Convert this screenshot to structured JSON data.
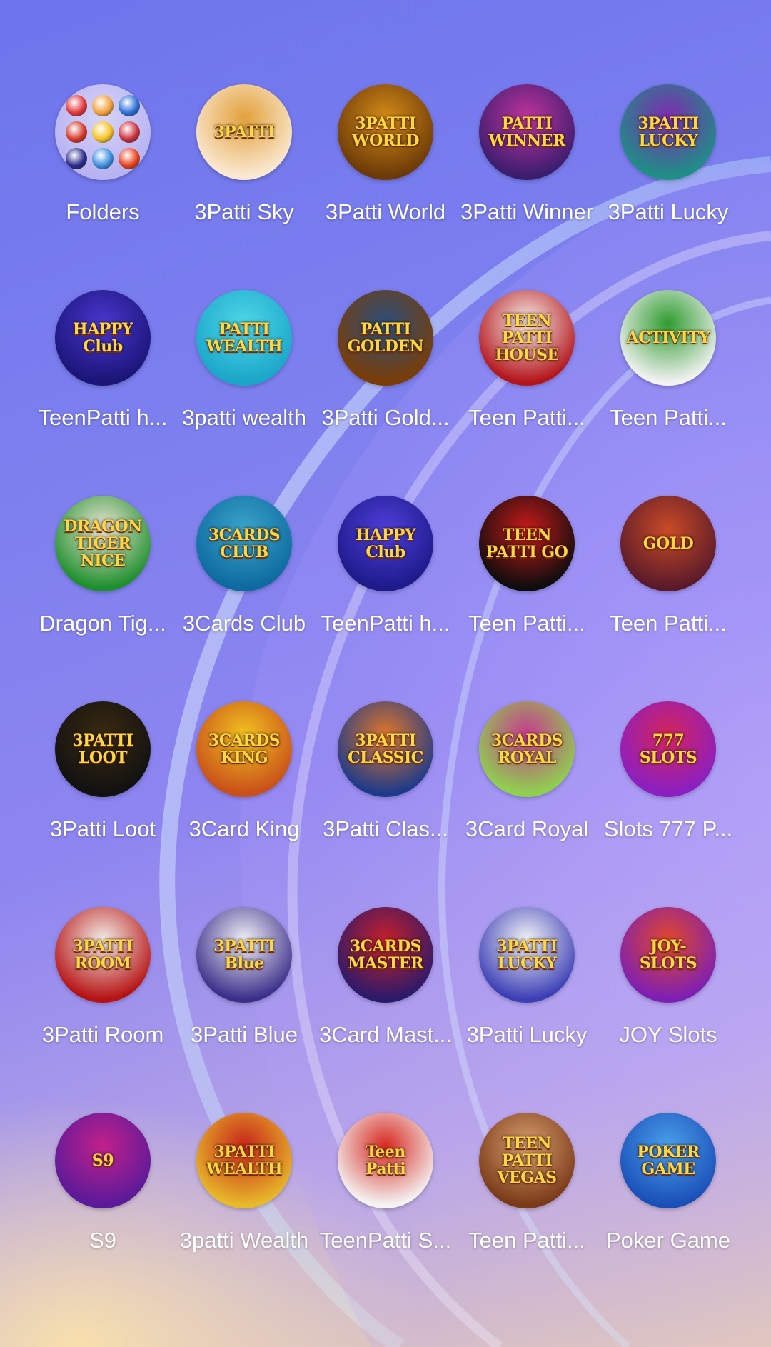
{
  "home_screen": {
    "apps": [
      {
        "label": "Folders",
        "icon": "folder-icon",
        "kind": "folder",
        "icon_text": "",
        "colors": [
          "#b7b2f2",
          "#d6d3f7"
        ]
      },
      {
        "label": "3Patti Sky",
        "icon": "3patti-sky-icon",
        "icon_text": "3PATTI",
        "colors": [
          "#fbe9d3",
          "#e2a13a"
        ]
      },
      {
        "label": "3Patti World",
        "icon": "3patti-world-icon",
        "icon_text": "3PATTI WORLD",
        "colors": [
          "#6b3a07",
          "#d48a18"
        ]
      },
      {
        "label": "3Patti Winner",
        "icon": "3patti-winner-icon",
        "icon_text": "PATTI WINNER",
        "colors": [
          "#3a1d6e",
          "#c0339b"
        ]
      },
      {
        "label": "3Patti Lucky",
        "icon": "3patti-lucky-icon",
        "icon_text": "3PATTI LUCKY",
        "colors": [
          "#1e8f86",
          "#7e2ab0"
        ]
      },
      {
        "label": "TeenPatti h...",
        "icon": "teenpatti-happy-club-icon",
        "icon_text": "HAPPY Club",
        "colors": [
          "#1a1577",
          "#4a36d0"
        ]
      },
      {
        "label": "3patti wealth",
        "icon": "3patti-wealth-icon",
        "icon_text": "PATTI WEALTH",
        "colors": [
          "#1ba6c9",
          "#4dd7e8"
        ]
      },
      {
        "label": "3Patti Gold...",
        "icon": "3patti-golden-icon",
        "icon_text": "PATTI GOLDEN",
        "colors": [
          "#7a3d07",
          "#2b4e7a"
        ]
      },
      {
        "label": "Teen Patti...",
        "icon": "teen-patti-house-icon",
        "icon_text": "TEEN PATTI HOUSE",
        "colors": [
          "#b3141a",
          "#f7f0ea"
        ]
      },
      {
        "label": "Teen Patti...",
        "icon": "teen-patti-activity-icon",
        "icon_text": "ACTIVITY",
        "colors": [
          "#f2f2f2",
          "#2f9c2f"
        ]
      },
      {
        "label": "Dragon Tig...",
        "icon": "dragon-tiger-icon",
        "icon_text": "DRAGON TIGER NICE",
        "colors": [
          "#1d8f2c",
          "#f0e6d8"
        ]
      },
      {
        "label": "3Cards Club",
        "icon": "3cards-club-icon",
        "icon_text": "3CARDS CLUB",
        "colors": [
          "#0e6aa0",
          "#3aa4c9"
        ]
      },
      {
        "label": "TeenPatti h...",
        "icon": "teenpatti-happy-club-2-icon",
        "icon_text": "HAPPY Club",
        "colors": [
          "#1d1a8a",
          "#4f3ed9"
        ]
      },
      {
        "label": "Teen Patti...",
        "icon": "teen-patti-go-icon",
        "icon_text": "TEEN PATTI GO",
        "colors": [
          "#0d0d0d",
          "#c81a1a"
        ]
      },
      {
        "label": "Teen Patti...",
        "icon": "teen-patti-gold-icon",
        "icon_text": "GOLD",
        "colors": [
          "#5a1a2a",
          "#c94a26"
        ]
      },
      {
        "label": "3Patti Loot",
        "icon": "3patti-loot-icon",
        "icon_text": "3PATTI LOOT",
        "colors": [
          "#111111",
          "#3a2a10"
        ]
      },
      {
        "label": "3Card King",
        "icon": "3card-king-icon",
        "icon_text": "3CARDS KING",
        "colors": [
          "#c9501a",
          "#f1c21f"
        ]
      },
      {
        "label": "3Patti Clas...",
        "icon": "3patti-classic-icon",
        "icon_text": "3PATTI CLASSIC",
        "colors": [
          "#1d3a8a",
          "#e0762a"
        ]
      },
      {
        "label": "3Card Royal",
        "icon": "3card-royal-icon",
        "icon_text": "3CARDS ROYAL",
        "colors": [
          "#8fd14f",
          "#c53a8e"
        ]
      },
      {
        "label": "Slots 777 P...",
        "icon": "slots-777-icon",
        "icon_text": "777 SLOTS",
        "colors": [
          "#8a1fc2",
          "#d4245c"
        ]
      },
      {
        "label": "3Patti Room",
        "icon": "3patti-room-icon",
        "icon_text": "3PATTI ROOM",
        "colors": [
          "#b51212",
          "#f4efe9"
        ]
      },
      {
        "label": "3Patti Blue",
        "icon": "3patti-blue-icon",
        "icon_text": "3PATTI Blue",
        "colors": [
          "#3b2f8a",
          "#f1f1f6"
        ]
      },
      {
        "label": "3Card Mast...",
        "icon": "3card-master-icon",
        "icon_text": "3CARDS MASTER",
        "colors": [
          "#2b1a6a",
          "#c81f2a"
        ]
      },
      {
        "label": "3Patti Lucky",
        "icon": "3patti-lucky-2-icon",
        "icon_text": "3PATTI LUCKY",
        "colors": [
          "#3b3fb5",
          "#f4f4f7"
        ]
      },
      {
        "label": "JOY Slots",
        "icon": "joy-slots-icon",
        "icon_text": "JOY-SLOTS",
        "colors": [
          "#7d1fb5",
          "#e2472a"
        ]
      },
      {
        "label": "S9",
        "icon": "s9-icon",
        "icon_text": "S9",
        "colors": [
          "#5a1a9a",
          "#c1208a"
        ]
      },
      {
        "label": "3patti Wealth",
        "icon": "3patti-wealth-2-icon",
        "icon_text": "3PATTI WEALTH",
        "colors": [
          "#e8b92a",
          "#c7241a"
        ]
      },
      {
        "label": "TeenPatti S...",
        "icon": "teenpatti-s-icon",
        "icon_text": "Teen Patti",
        "colors": [
          "#f4f4f4",
          "#d7281f"
        ]
      },
      {
        "label": "Teen Patti...",
        "icon": "teen-patti-vegas-icon",
        "icon_text": "TEEN PATTI VEGAS",
        "colors": [
          "#7a3a18",
          "#d9a070"
        ]
      },
      {
        "label": "Poker Game",
        "icon": "poker-game-icon",
        "icon_text": "POKER GAME",
        "colors": [
          "#1a4fb8",
          "#4aa0ea"
        ]
      }
    ]
  }
}
